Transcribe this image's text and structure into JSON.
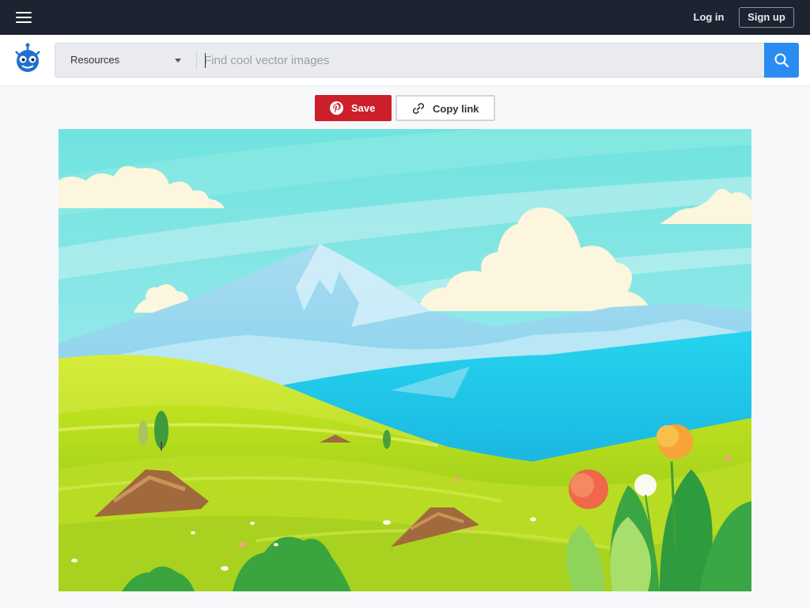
{
  "topbar": {
    "menu_icon": "hamburger-icon",
    "login_label": "Log in",
    "signup_label": "Sign up"
  },
  "search": {
    "category_label": "Resources",
    "placeholder": "Find cool vector images",
    "value": "",
    "search_icon": "magnifier-icon"
  },
  "actions": {
    "save_label": "Save",
    "copy_link_label": "Copy link"
  },
  "colors": {
    "topbar_bg": "#1d2330",
    "search_accent": "#2a8cf0",
    "save_red": "#cc1f2a"
  }
}
